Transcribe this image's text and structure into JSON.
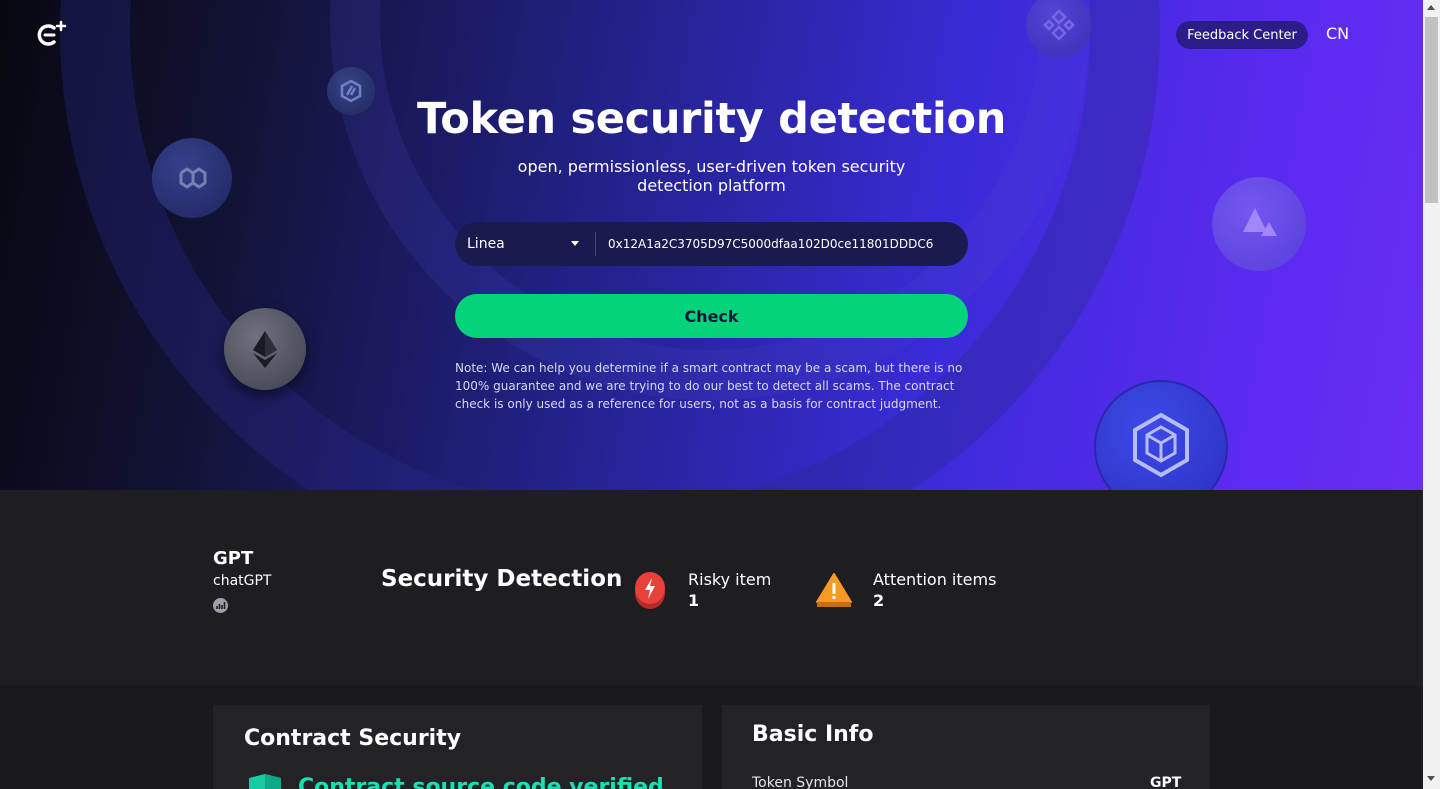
{
  "header": {
    "logo_icon": "cs-logo-icon",
    "feedback_label": "Feedback Center",
    "language_label": "CN"
  },
  "hero": {
    "title": "Token security detection",
    "subtitle": "open, permissionless, user-driven token security detection platform",
    "chain_selected": "Linea",
    "address_value": "0x12A1a2C3705D97C5000dfaa102D0ce11801DDDC6",
    "check_label": "Check",
    "note": "Note: We can help you determine if a smart contract may be a scam, but there is no 100% guarantee and we are trying to do our best to detect all scams. The contract check is only used as a reference for users, not as a basis for contract judgment.",
    "decorative_coins": [
      "polygon-icon",
      "arbitrum-icon",
      "ethereum-icon",
      "bnb-icon",
      "avalanche-icon",
      "chainlink-icon"
    ]
  },
  "token": {
    "symbol": "GPT",
    "name": "chatGPT",
    "chart_icon": "chart-icon"
  },
  "security": {
    "title": "Security Detection",
    "risky_label": "Risky item",
    "risky_count": "1",
    "risky_color": "#e8403a",
    "attention_label": "Attention items",
    "attention_count": "2",
    "attention_color": "#f59a23"
  },
  "contract_security": {
    "title": "Contract Security",
    "verified_text": "Contract source code verified",
    "verified_color": "#18e0b0"
  },
  "basic_info": {
    "title": "Basic Info",
    "rows": [
      {
        "label": "Token Symbol",
        "value": "GPT"
      }
    ]
  },
  "colors": {
    "check_button": "#03d37b",
    "feedback_button": "#2a1d8a",
    "page_bg": "#1e1e22"
  }
}
